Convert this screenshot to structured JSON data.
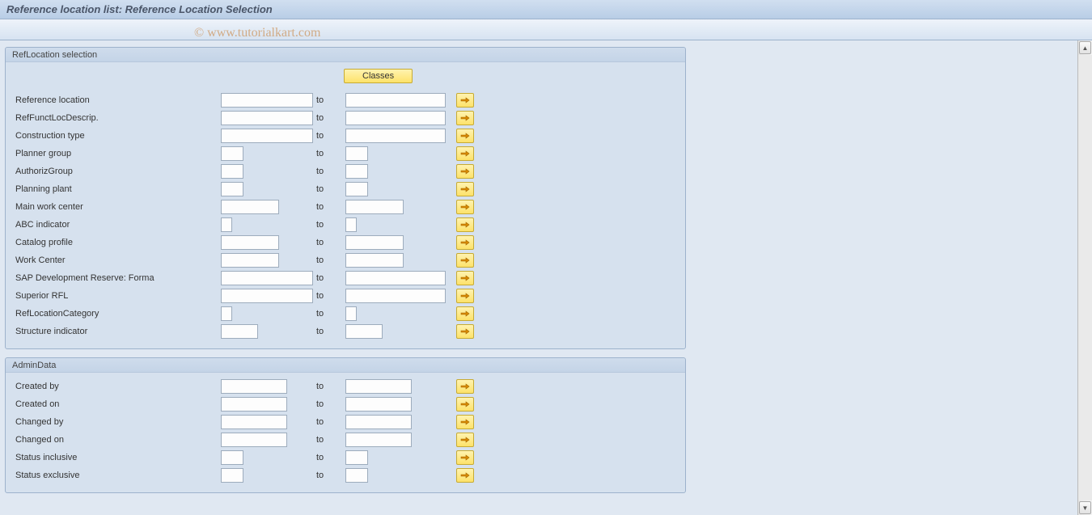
{
  "header": {
    "title": "Reference location list: Reference Location Selection",
    "watermark": "© www.tutorialkart.com"
  },
  "buttons": {
    "classes": "Classes"
  },
  "labels": {
    "to": "to"
  },
  "groups": {
    "selection": {
      "legend": "RefLocation selection"
    },
    "admin": {
      "legend": "AdminData"
    }
  },
  "selection_rows": [
    {
      "label": "Reference location",
      "from_size": "full",
      "to_size": "full"
    },
    {
      "label": "RefFunctLocDescrip.",
      "from_size": "full",
      "to_size": "full"
    },
    {
      "label": "Construction type",
      "from_size": "full",
      "to_size": "full"
    },
    {
      "label": "Planner group",
      "from_size": "sm",
      "to_size": "sm"
    },
    {
      "label": "AuthorizGroup",
      "from_size": "sm",
      "to_size": "sm"
    },
    {
      "label": "Planning plant",
      "from_size": "sm",
      "to_size": "sm"
    },
    {
      "label": "Main work center",
      "from_size": "mmd",
      "to_size": "mmd"
    },
    {
      "label": "ABC indicator",
      "from_size": "xs",
      "to_size": "xs"
    },
    {
      "label": "Catalog profile",
      "from_size": "mmd",
      "to_size": "mmd"
    },
    {
      "label": "Work Center",
      "from_size": "mmd",
      "to_size": "mmd"
    },
    {
      "label": "SAP Development Reserve: Forma",
      "from_size": "full",
      "to_size": "full"
    },
    {
      "label": "Superior RFL",
      "from_size": "full",
      "to_size": "full"
    },
    {
      "label": "RefLocationCategory",
      "from_size": "xs",
      "to_size": "xs"
    },
    {
      "label": "Structure indicator",
      "from_size": "md",
      "to_size": "md"
    }
  ],
  "admin_rows": [
    {
      "label": "Created by",
      "from_size": "lmd",
      "to_size": "lmd"
    },
    {
      "label": "Created on",
      "from_size": "lmd",
      "to_size": "lmd"
    },
    {
      "label": "Changed by",
      "from_size": "lmd",
      "to_size": "lmd"
    },
    {
      "label": "Changed on",
      "from_size": "lmd",
      "to_size": "lmd"
    },
    {
      "label": "Status inclusive",
      "from_size": "sm",
      "to_size": "sm"
    },
    {
      "label": "Status exclusive",
      "from_size": "sm",
      "to_size": "sm"
    }
  ],
  "icons": {
    "multiple_selection": "arrow-right"
  }
}
